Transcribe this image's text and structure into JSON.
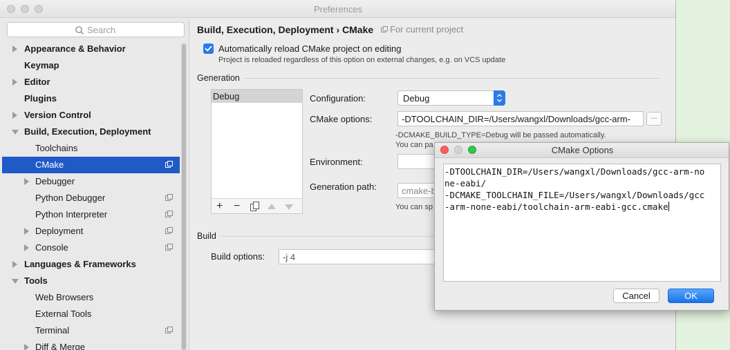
{
  "window": {
    "title": "Preferences"
  },
  "sidebar": {
    "search_placeholder": "Search",
    "items": [
      {
        "label": "Appearance & Behavior",
        "bold": true
      },
      {
        "label": "Keymap",
        "bold": true
      },
      {
        "label": "Editor",
        "bold": true
      },
      {
        "label": "Plugins",
        "bold": true
      },
      {
        "label": "Version Control",
        "bold": true
      },
      {
        "label": "Build, Execution, Deployment",
        "bold": true
      },
      {
        "label": "Toolchains"
      },
      {
        "label": "CMake",
        "selected": true
      },
      {
        "label": "Debugger"
      },
      {
        "label": "Python Debugger"
      },
      {
        "label": "Python Interpreter"
      },
      {
        "label": "Deployment"
      },
      {
        "label": "Console"
      },
      {
        "label": "Languages & Frameworks",
        "bold": true
      },
      {
        "label": "Tools",
        "bold": true
      },
      {
        "label": "Web Browsers"
      },
      {
        "label": "External Tools"
      },
      {
        "label": "Terminal"
      },
      {
        "label": "Diff & Merge"
      }
    ]
  },
  "main": {
    "breadcrumb": "Build, Execution, Deployment › CMake",
    "for_project": "For current project",
    "auto_reload_label": "Automatically reload CMake project on editing",
    "auto_reload_hint": "Project is reloaded regardless of this option on external changes, e.g. on VCS update",
    "generation_title": "Generation",
    "profiles": [
      "Debug"
    ],
    "configuration_label": "Configuration:",
    "configuration_value": "Debug",
    "cmake_options_label": "CMake options:",
    "cmake_options_value": "-DTOOLCHAIN_DIR=/Users/wangxl/Downloads/gcc-arm-",
    "cmake_options_btn": "...",
    "hint_build_type": "-DCMAKE_BUILD_TYPE=Debug will be passed automatically.",
    "hint_you_can_pa": "You can pa",
    "environment_label": "Environment:",
    "generation_path_label": "Generation path:",
    "generation_path_value": "cmake-b",
    "hint_you_can_sp": "You can sp",
    "build_title": "Build",
    "build_options_label": "Build options:",
    "build_options_value": "-j 4"
  },
  "dialog": {
    "title": "CMake Options",
    "lines": [
      "-DTOOLCHAIN_DIR=/Users/wangxl/Downloads/gcc-arm-no",
      "ne-eabi/",
      "-DCMAKE_TOOLCHAIN_FILE=/Users/wangxl/Downloads/gcc",
      "-arm-none-eabi/toolchain-arm-eabi-gcc.cmake"
    ],
    "cancel_label": "Cancel",
    "ok_label": "OK"
  },
  "colors": {
    "selection": "#1f5ac7",
    "accent": "#2a7be6",
    "close_red": "#fc605b",
    "minimize_gray": "#d3d3d3",
    "zoom_green": "#34c84a"
  }
}
